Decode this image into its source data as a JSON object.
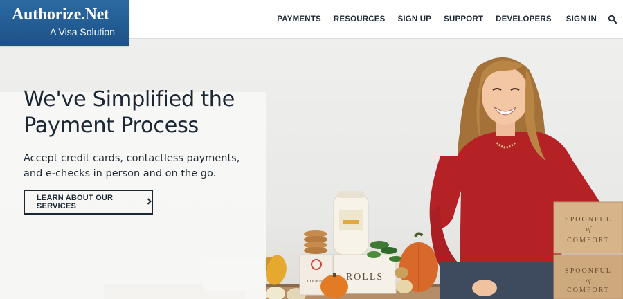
{
  "brand": {
    "name": "Authorize.Net",
    "tagline": "A Visa Solution",
    "color": "#205a93"
  },
  "nav": {
    "items": [
      "PAYMENTS",
      "RESOURCES",
      "SIGN UP",
      "SUPPORT",
      "DEVELOPERS"
    ],
    "sign_in": "SIGN IN",
    "search_icon": "search-icon"
  },
  "hero": {
    "title": "We've Simplified the Payment Process",
    "subtitle": "Accept credit cards, contactless payments, and e-checks in person and on the go.",
    "cta_label": "LEARN ABOUT OUR SERVICES",
    "cta_icon": "chevron-right-icon",
    "product_labels": {
      "rolls": "ROLLS",
      "cookies": "COOKIES",
      "box_line1": "SPOONFUL",
      "box_line2": "of",
      "box_line3": "COMFORT"
    }
  }
}
